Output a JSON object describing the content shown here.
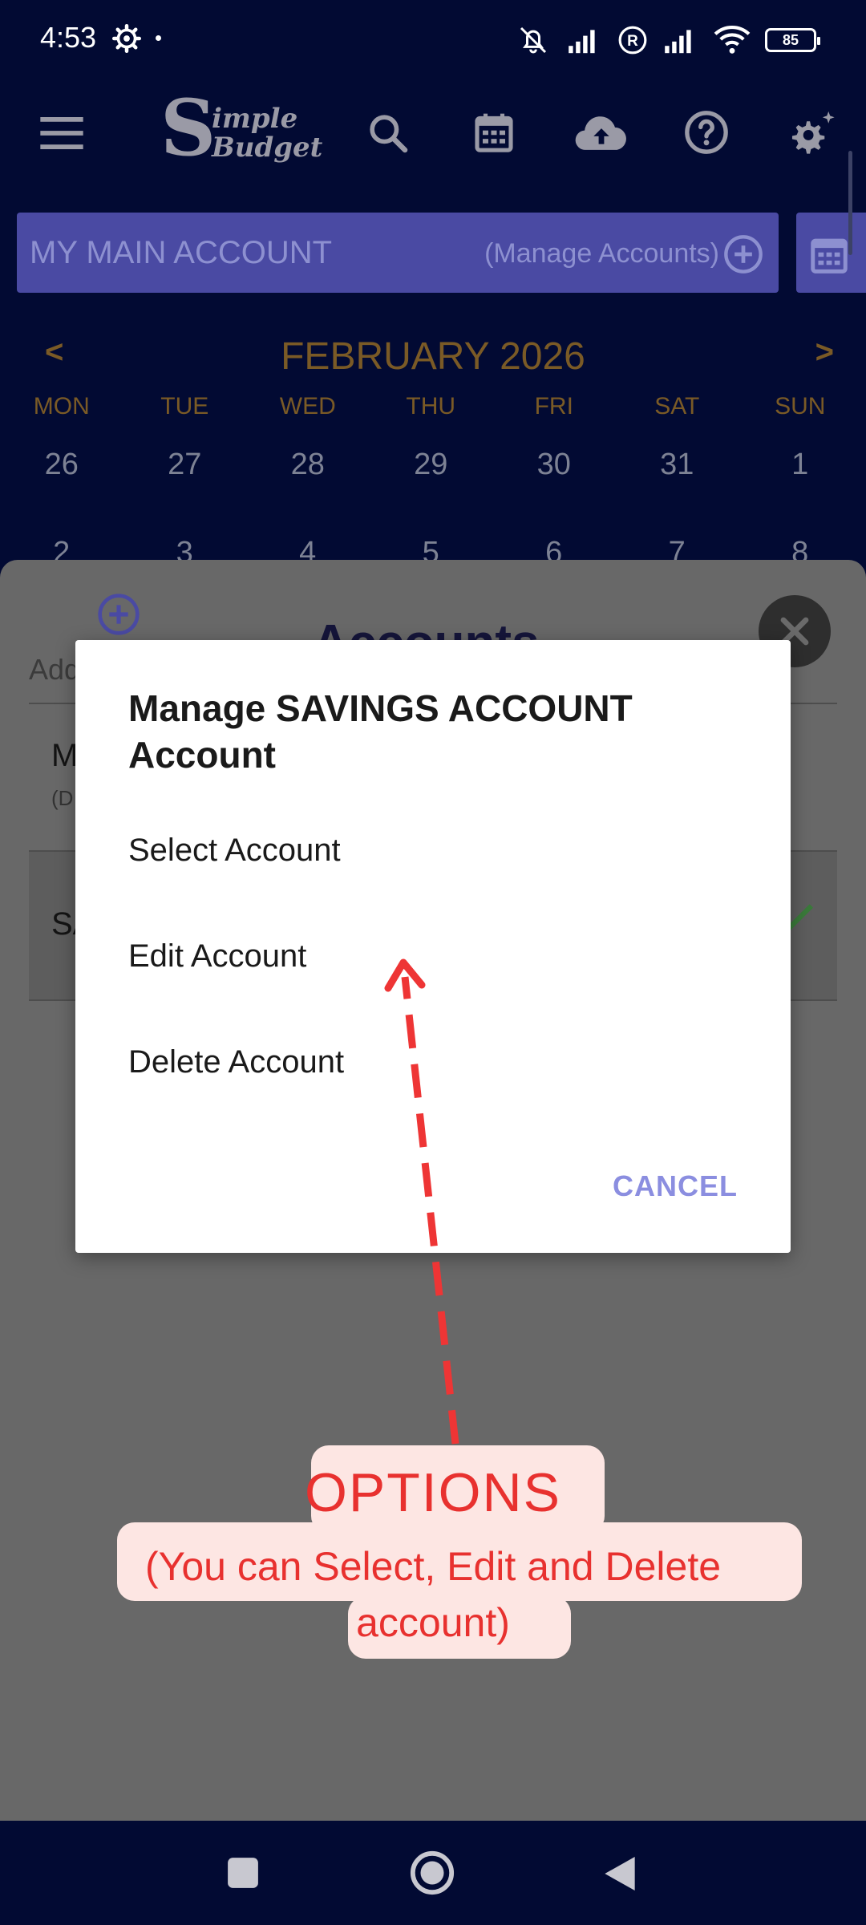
{
  "status_bar": {
    "time": "4:53",
    "battery": "85"
  },
  "app_bar": {
    "logo_line1": "imple",
    "logo_line2": "Budget",
    "logo_initial": "S"
  },
  "account_bar": {
    "name": "MY MAIN ACCOUNT",
    "manage_label": "(Manage Accounts)"
  },
  "calendar": {
    "prev": "<",
    "next": ">",
    "month": "FEBRUARY 2026",
    "weekdays": [
      "MON",
      "TUE",
      "WED",
      "THU",
      "FRI",
      "SAT",
      "SUN"
    ],
    "week1": [
      "26",
      "27",
      "28",
      "29",
      "30",
      "31",
      "1"
    ],
    "week2": [
      "2",
      "3",
      "4",
      "5",
      "6",
      "7",
      "8"
    ]
  },
  "sheet": {
    "title": "Accounts",
    "add_placeholder": "Add",
    "rows": [
      {
        "name": "M",
        "sub": "(D"
      },
      {
        "name": "SA"
      }
    ]
  },
  "dialog": {
    "title": "Manage SAVINGS ACCOUNT Account",
    "options": [
      "Select Account",
      "Edit Account",
      "Delete Account"
    ],
    "cancel": "CANCEL"
  },
  "annotation": {
    "title": "OPTIONS",
    "line1": "(You can Select, Edit and Delete",
    "line2": "account)",
    "color": "#e8312f"
  },
  "colors": {
    "background": "#020a33",
    "account_bar": "#4a4aa3",
    "calendar_header": "#7a5a26",
    "dialog_action": "#8b8ee0"
  }
}
